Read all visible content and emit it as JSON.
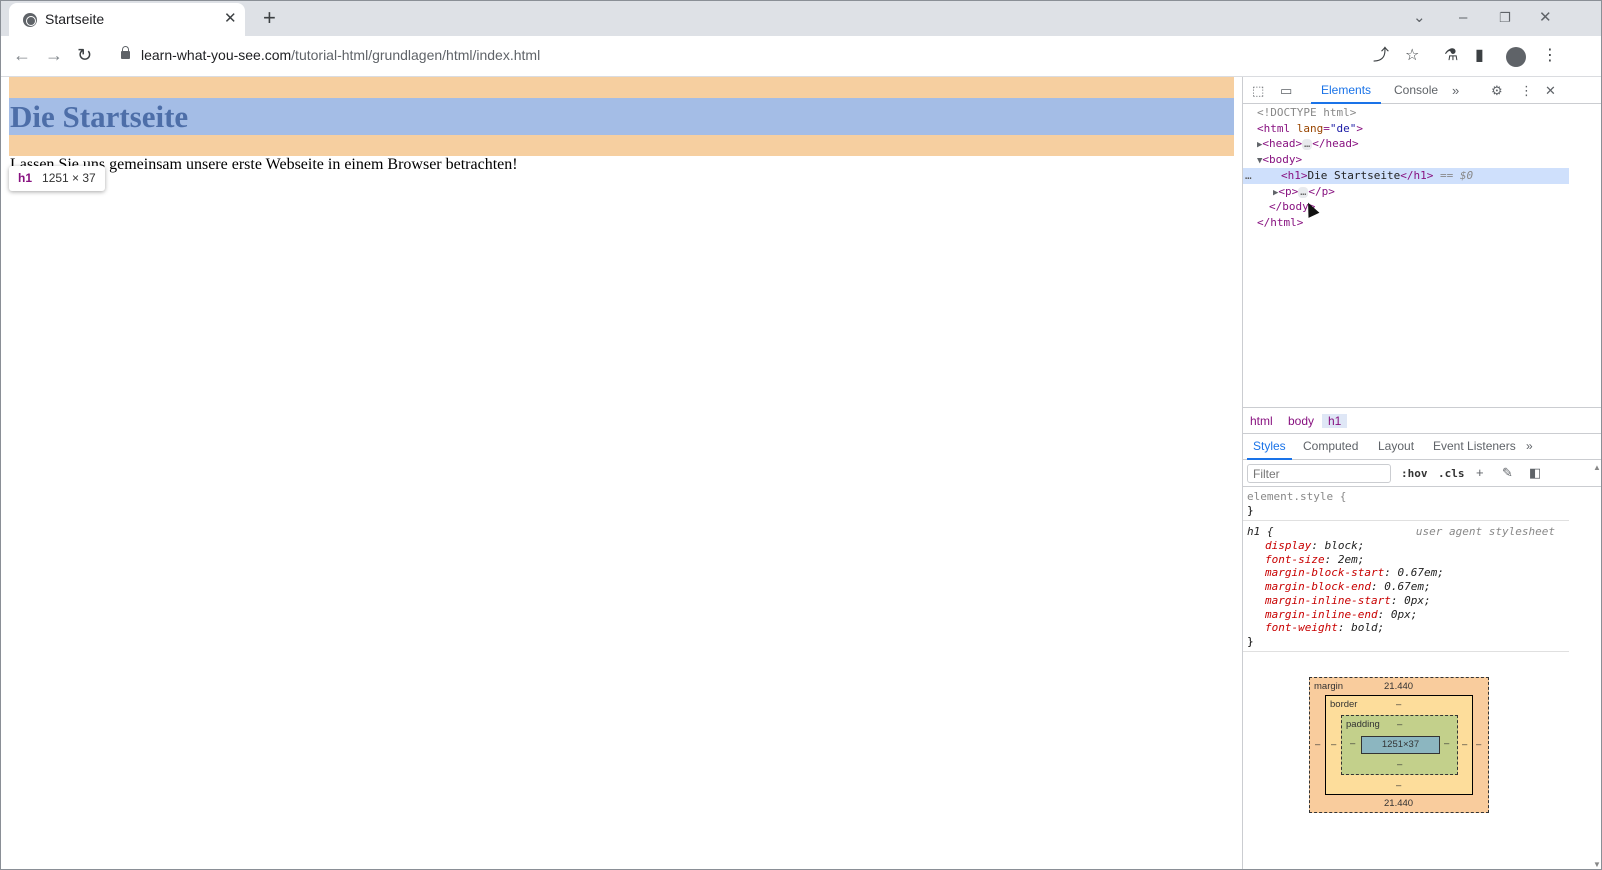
{
  "browser": {
    "tab_title": "Startseite",
    "tab_close": "✕",
    "new_tab": "+",
    "url_host": "learn-what-you-see.com",
    "url_path": "/tutorial-html/grundlagen/html/index.html"
  },
  "page": {
    "heading": "Die Startseite",
    "paragraph": "Lassen Sie uns gemeinsam unsere erste Webseite in einem Browser betrachten!",
    "tooltip_tag": "h1",
    "tooltip_dims": "1251 × 37"
  },
  "devtools": {
    "tabs": [
      "Elements",
      "Console"
    ],
    "more": "»",
    "dom": {
      "doctype": "<!DOCTYPE html>",
      "html_open_tag": "<html",
      "html_attr": "lang",
      "html_attr_val": "\"de\"",
      "html_open_end": ">",
      "head": "<head>",
      "head_end": "</head>",
      "ellipsis": "…",
      "body": "<body>",
      "h1_open": "<h1>",
      "h1_text": "Die Startseite",
      "h1_close": "</h1>",
      "selected_marker": "== $0",
      "p_open": "<p>",
      "p_close": "</p>",
      "body_close": "</body>",
      "html_close": "</html>",
      "row_dots": "…"
    },
    "breadcrumbs": [
      "html",
      "body",
      "h1"
    ],
    "style_tabs": [
      "Styles",
      "Computed",
      "Layout",
      "Event Listeners"
    ],
    "filter_placeholder": "Filter",
    "hov": ":hov",
    "cls": ".cls",
    "styles": {
      "element_style": "element.style {",
      "close_brace": "}",
      "h1_selector": "h1 {",
      "user_agent": "user agent stylesheet",
      "props": [
        {
          "name": "display",
          "value": "block;"
        },
        {
          "name": "font-size",
          "value": "2em;"
        },
        {
          "name": "margin-block-start",
          "value": "0.67em;"
        },
        {
          "name": "margin-block-end",
          "value": "0.67em;"
        },
        {
          "name": "margin-inline-start",
          "value": "0px;"
        },
        {
          "name": "margin-inline-end",
          "value": "0px;"
        },
        {
          "name": "font-weight",
          "value": "bold;"
        }
      ]
    },
    "box_model": {
      "margin_label": "margin",
      "margin_top": "21.440",
      "margin_bottom": "21.440",
      "margin_side": "–",
      "border_label": "border",
      "border_val": "–",
      "padding_label": "padding",
      "padding_val": "–",
      "content": "1251×37"
    }
  },
  "colors": {
    "margin_highlight": "#f6cfa0",
    "content_highlight": "#a4bde6",
    "accent": "#1a73e8"
  }
}
